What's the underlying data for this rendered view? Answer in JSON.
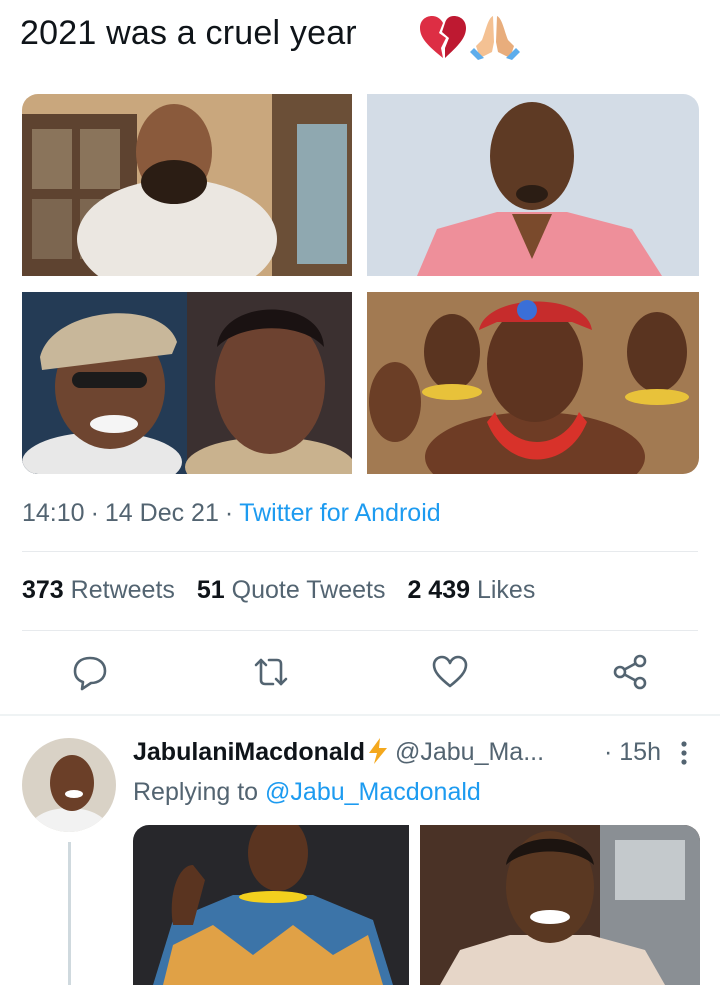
{
  "tweet": {
    "text": "2021 was a cruel year",
    "emojis": [
      "broken-heart",
      "folded-hands"
    ],
    "time": "14:10",
    "date": "14 Dec 21",
    "source": "Twitter for Android",
    "stats": {
      "retweets_count": "373",
      "retweets_label": "Retweets",
      "quotes_count": "51",
      "quotes_label": "Quote Tweets",
      "likes_count": "2 439",
      "likes_label": "Likes"
    },
    "actions": [
      "reply-icon",
      "retweet-icon",
      "like-icon",
      "share-icon"
    ]
  },
  "reply": {
    "name": "JabulaniMacdonald",
    "handle": "@Jabu_Ma...",
    "separator": "·",
    "time": "15h",
    "replying_prefix": "Replying to",
    "replying_to": "@Jabu_Macdonald"
  },
  "colors": {
    "link": "#1d9bf0",
    "secondary_text": "#536471",
    "primary_text": "#0f1419",
    "divider": "#e7eaed"
  }
}
